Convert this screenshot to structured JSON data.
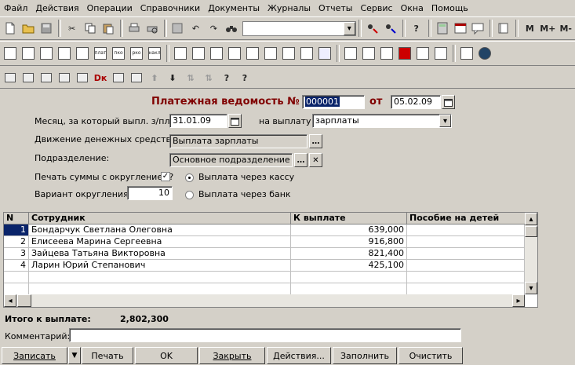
{
  "menu": [
    "Файл",
    "Действия",
    "Операции",
    "Справочники",
    "Документы",
    "Журналы",
    "Отчеты",
    "Сервис",
    "Окна",
    "Помощь"
  ],
  "toolbar": {
    "m": "M",
    "m_plus": "M+",
    "m_minus": "M-"
  },
  "doc": {
    "title": "Платежная ведомость №",
    "number": "000001",
    "from_label": "от",
    "date": "05.02.09"
  },
  "month": {
    "label": "Месяц, за который выпл. з/пл:",
    "value": "31.01.09",
    "payout_label": "на выплату",
    "payout_value": "зарплаты"
  },
  "cashflow": {
    "label": "Движение денежных средств:",
    "value": "Выплата зарплаты"
  },
  "division": {
    "label": "Подразделение:",
    "value": "Основное подразделение"
  },
  "rounding": {
    "print_label": "Печать суммы с округлением?",
    "variant_label": "Вариант округления:",
    "variant_value": "10"
  },
  "pay_mode": {
    "cash": "Выплата через кассу",
    "bank": "Выплата через банк",
    "selected": "cash"
  },
  "table": {
    "columns": [
      "N",
      "Сотрудник",
      "К выплате",
      "Пособие на детей"
    ],
    "rows": [
      {
        "n": "1",
        "name": "Бондарчук Светлана Олеговна",
        "amount": "639,000",
        "benefit": ""
      },
      {
        "n": "2",
        "name": "Елисеева Марина Сергеевна",
        "amount": "916,800",
        "benefit": ""
      },
      {
        "n": "3",
        "name": "Зайцева Татьяна Викторовна",
        "amount": "821,400",
        "benefit": ""
      },
      {
        "n": "4",
        "name": "Ларин Юрий Степанович",
        "amount": "425,100",
        "benefit": ""
      }
    ]
  },
  "total": {
    "label": "Итого к выплате:",
    "value": "2,802,300"
  },
  "comment": {
    "label": "Комментарий:",
    "value": ""
  },
  "buttons": {
    "save": "Записать",
    "print": "Печать",
    "ok": "OK",
    "close": "Закрыть",
    "actions": "Действия...",
    "fill": "Заполнить",
    "clear": "Очистить"
  },
  "colors": {
    "title": "#800000",
    "selection": "#0a246a",
    "panel": "#d4d0c8"
  }
}
